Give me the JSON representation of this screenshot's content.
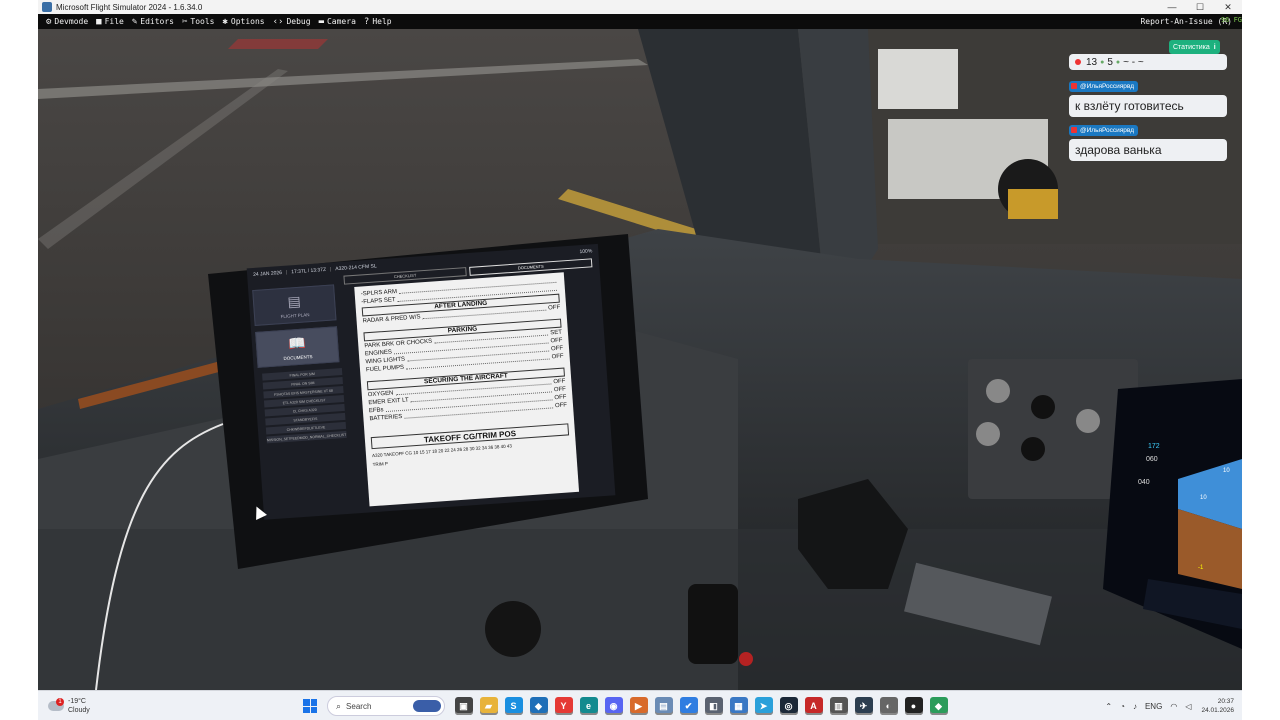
{
  "window": {
    "title": "Microsoft Flight Simulator 2024 - 1.6.34.0",
    "minimize": "—",
    "maximize": "☐",
    "close": "✕"
  },
  "devbar": {
    "items": [
      {
        "icon": "devmode-icon",
        "glyph": "⚙",
        "label": "Devmode"
      },
      {
        "icon": "folder-icon",
        "glyph": "■",
        "label": "File"
      },
      {
        "icon": "pencil-icon",
        "glyph": "✎",
        "label": "Editors"
      },
      {
        "icon": "tools-icon",
        "glyph": "✂",
        "label": "Tools"
      },
      {
        "icon": "gear-icon",
        "glyph": "✱",
        "label": "Options"
      },
      {
        "icon": "code-icon",
        "glyph": "‹›",
        "label": "Debug"
      },
      {
        "icon": "camera-icon",
        "glyph": "▬",
        "label": "Camera"
      },
      {
        "icon": "help-icon",
        "glyph": "?",
        "label": "Help"
      }
    ],
    "right_label": "Report-An-Issue (R)",
    "fps": "96 FG"
  },
  "efb": {
    "date": "24 JAN 2026",
    "time": "17:37L / 13:37Z",
    "aircraft": "A320-214 CFM SL",
    "battery": "100%",
    "side_buttons": [
      {
        "label": "FLIGHT PLAN",
        "icon": "document-icon",
        "glyph": "▤"
      },
      {
        "label": "DOCUMENTS",
        "icon": "book-icon",
        "glyph": "📖"
      }
    ],
    "doc_list": [
      "FINAL FOR SIM",
      "FINAL ON SIM",
      "FSHOTAS EFIS MASTERSINE XT 68",
      "ETL A320 SIM CHECKLIST",
      "CL CHKS A320",
      "STANDBYEFIS",
      "CHKWBREFDLIFTLEVE",
      "MISSION_SETFEEDMOD_NORMAL_CHECKLIST"
    ],
    "tabs": [
      "CHECKLIST",
      "DOCUMENTS"
    ],
    "checklist": {
      "pre_items": [
        {
          "item": "-SPLRS ARM",
          "val": ""
        },
        {
          "item": "-FLAPS SET",
          "val": ""
        }
      ],
      "sections": [
        {
          "title": "AFTER LANDING",
          "items": [
            {
              "item": "RADAR & PRED W/S",
              "val": "OFF"
            }
          ]
        },
        {
          "title": "PARKING",
          "items": [
            {
              "item": "PARK BRK OR CHOCKS",
              "val": "SET"
            },
            {
              "item": "ENGINES",
              "val": "OFF"
            },
            {
              "item": "WING LIGHTS",
              "val": "OFF"
            },
            {
              "item": "FUEL PUMPS",
              "val": "OFF"
            }
          ]
        },
        {
          "title": "SECURING THE AIRCRAFT",
          "items": [
            {
              "item": "OXYGEN",
              "val": "OFF"
            },
            {
              "item": "EMER EXIT LT",
              "val": "OFF"
            },
            {
              "item": "EFBs",
              "val": "OFF"
            },
            {
              "item": "BATTERIES",
              "val": "OFF"
            }
          ]
        }
      ],
      "takeoff_title": "TAKEOFF CG/TRIM POS",
      "takeoff_cg_label": "TAKEOFF CG",
      "trim_label": "TRIM P",
      "scale": "10 15 17 18 20 22 24 26 28 30 32 34 36 38 40 43",
      "side_label": "A320"
    }
  },
  "chat": {
    "stats_label": "Статистика",
    "counter": {
      "likes": "13",
      "viewers": "5",
      "extra": "~ - ~"
    },
    "messages": [
      {
        "author": "@ИльяРоссиярвд",
        "text": "к взлёту готовитесь"
      },
      {
        "author": "@ИльяРоссиярвд",
        "text": "здарова ванька"
      }
    ]
  },
  "cockpit": {
    "speed_ticks": [
      "172",
      "060",
      "040"
    ],
    "pitch_ticks": [
      "10",
      "10",
      "-1"
    ]
  },
  "taskbar": {
    "weather_temp": "-19°C",
    "weather_desc": "Cloudy",
    "weather_alert": "1",
    "search_label": "Search",
    "apps": [
      {
        "name": "task-view-icon",
        "glyph": "▣",
        "color": "#444"
      },
      {
        "name": "file-explorer-icon",
        "glyph": "▰",
        "color": "#e8b33a"
      },
      {
        "name": "skype-icon",
        "glyph": "S",
        "color": "#1a8fe0"
      },
      {
        "name": "vscode-icon",
        "glyph": "◆",
        "color": "#1f6fb8"
      },
      {
        "name": "yandex-icon",
        "glyph": "Y",
        "color": "#e53935"
      },
      {
        "name": "edge-icon",
        "glyph": "e",
        "color": "#138a8f"
      },
      {
        "name": "discord-icon",
        "glyph": "◉",
        "color": "#5865f2"
      },
      {
        "name": "media-icon",
        "glyph": "▶",
        "color": "#d86a2b"
      },
      {
        "name": "notepad-icon",
        "glyph": "▤",
        "color": "#6a8bb5"
      },
      {
        "name": "todo-icon",
        "glyph": "✔",
        "color": "#2f7de1"
      },
      {
        "name": "app-icon-1",
        "glyph": "◧",
        "color": "#5a6270"
      },
      {
        "name": "app-icon-2",
        "glyph": "▦",
        "color": "#3a78c4"
      },
      {
        "name": "telegram-icon",
        "glyph": "➤",
        "color": "#2aa0da"
      },
      {
        "name": "steam-icon",
        "glyph": "◎",
        "color": "#1b2838"
      },
      {
        "name": "acrobat-icon",
        "glyph": "A",
        "color": "#c62828"
      },
      {
        "name": "app-icon-3",
        "glyph": "▥",
        "color": "#555"
      },
      {
        "name": "msfs-icon",
        "glyph": "✈",
        "color": "#2c3e50"
      },
      {
        "name": "app-icon-4",
        "glyph": "◐",
        "color": "#666"
      },
      {
        "name": "obs-icon",
        "glyph": "●",
        "color": "#222"
      },
      {
        "name": "app-icon-5",
        "glyph": "◆",
        "color": "#2b9c5a"
      }
    ],
    "tray_language": "ENG",
    "clock_time": "20:37",
    "clock_date": "24.01.2026"
  }
}
